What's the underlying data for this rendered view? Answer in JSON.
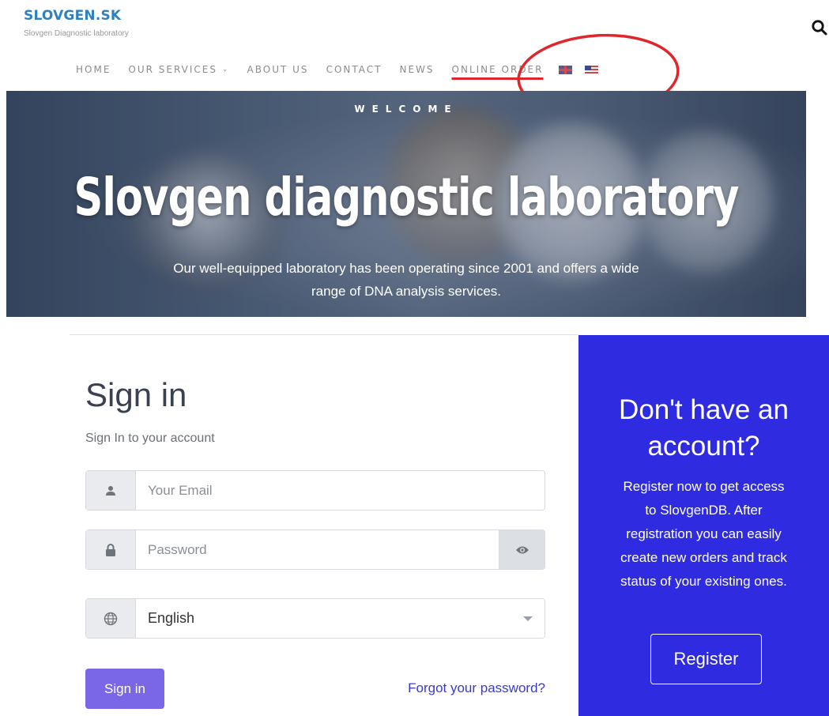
{
  "header": {
    "logo_title": "SLOVGEN.SK",
    "logo_subtitle": "Slovgen Diagnostic laboratory",
    "search_icon": "search-icon"
  },
  "nav": {
    "items": [
      {
        "label": "HOME"
      },
      {
        "label": "OUR SERVICES",
        "icon": "chevron-down-icon",
        "chevron": "⌄"
      },
      {
        "label": "ABOUT US"
      },
      {
        "label": "CONTACT"
      },
      {
        "label": "NEWS"
      },
      {
        "label": "ONLINE ORDER",
        "underline_color": "#e0262b"
      }
    ],
    "flags": [
      "uk-flag-icon",
      "us-flag-icon"
    ]
  },
  "hero": {
    "welcome": "WELCOME",
    "title": "Slovgen diagnostic laboratory",
    "description_line1": "Our well-equipped laboratory has been operating since 2001 and offers a wide",
    "description_line2": "range of DNA analysis services."
  },
  "signin": {
    "title": "Sign in",
    "subtitle": "Sign In to your account",
    "email_placeholder": "Your Email",
    "email_icon": "user-icon",
    "password_placeholder": "Password",
    "password_icon": "lock-icon",
    "toggle_icon": "eye-icon",
    "language_icon": "globe-icon",
    "language_selected": "English",
    "submit_label": "Sign in",
    "forgot_label": "Forgot your password?",
    "button_color": "#7a67e8",
    "link_color": "#3a3ad0"
  },
  "register": {
    "title_line1": "Don't have an",
    "title_line2": "account?",
    "text_line1": "Register now to get access",
    "text_line2": "to SlovgenDB. After",
    "text_line3": "registration you can easily",
    "text_line4": "create new orders and track",
    "text_line5": "status of your existing ones.",
    "button_label": "Register",
    "panel_color": "#2f2be0"
  },
  "annotation": {
    "color": "#e0262b"
  }
}
